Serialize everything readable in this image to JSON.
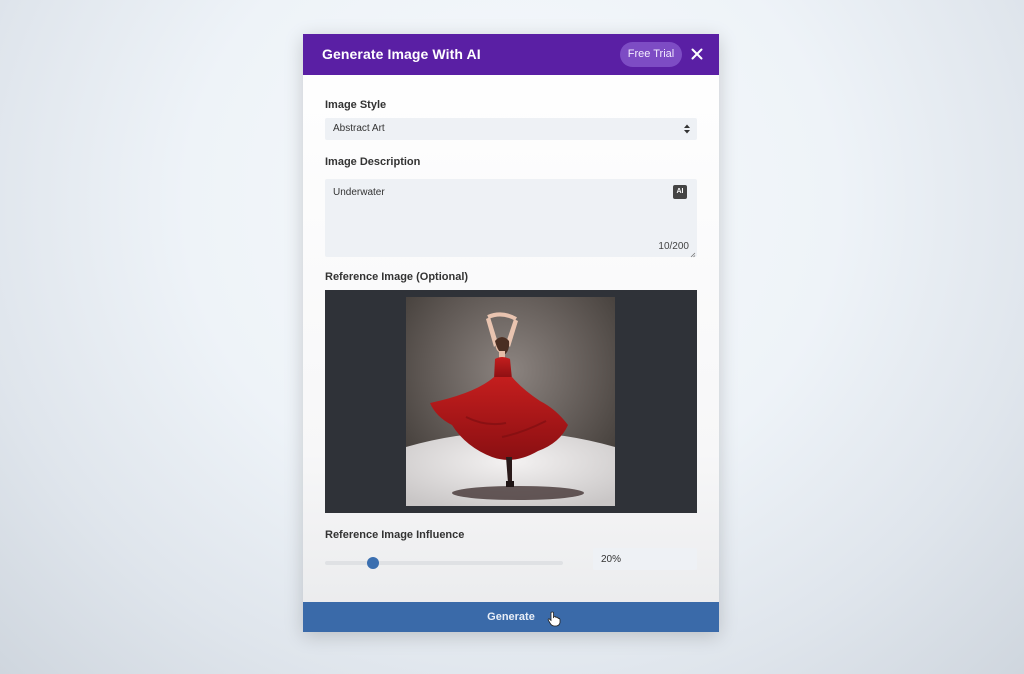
{
  "modal": {
    "title": "Generate Image With AI",
    "badge": "Free Trial",
    "close_icon": "close-icon"
  },
  "style": {
    "label": "Image Style",
    "value": "Abstract Art",
    "arrow_icon": "select-arrows-icon"
  },
  "description": {
    "label": "Image Description",
    "value": "Underwater",
    "ai_badge": "AI",
    "counter": "10/200"
  },
  "reference": {
    "label": "Reference Image (Optional)"
  },
  "influence": {
    "label": "Reference Image Influence",
    "value_text": "20%",
    "fraction": 0.2
  },
  "footer": {
    "generate_label": "Generate"
  },
  "colors": {
    "header": "#5a1fa4",
    "badge": "#7d4cc4",
    "generate": "#3a6aa9",
    "slider_thumb": "#3b6fb0",
    "dress": "#b01818"
  }
}
